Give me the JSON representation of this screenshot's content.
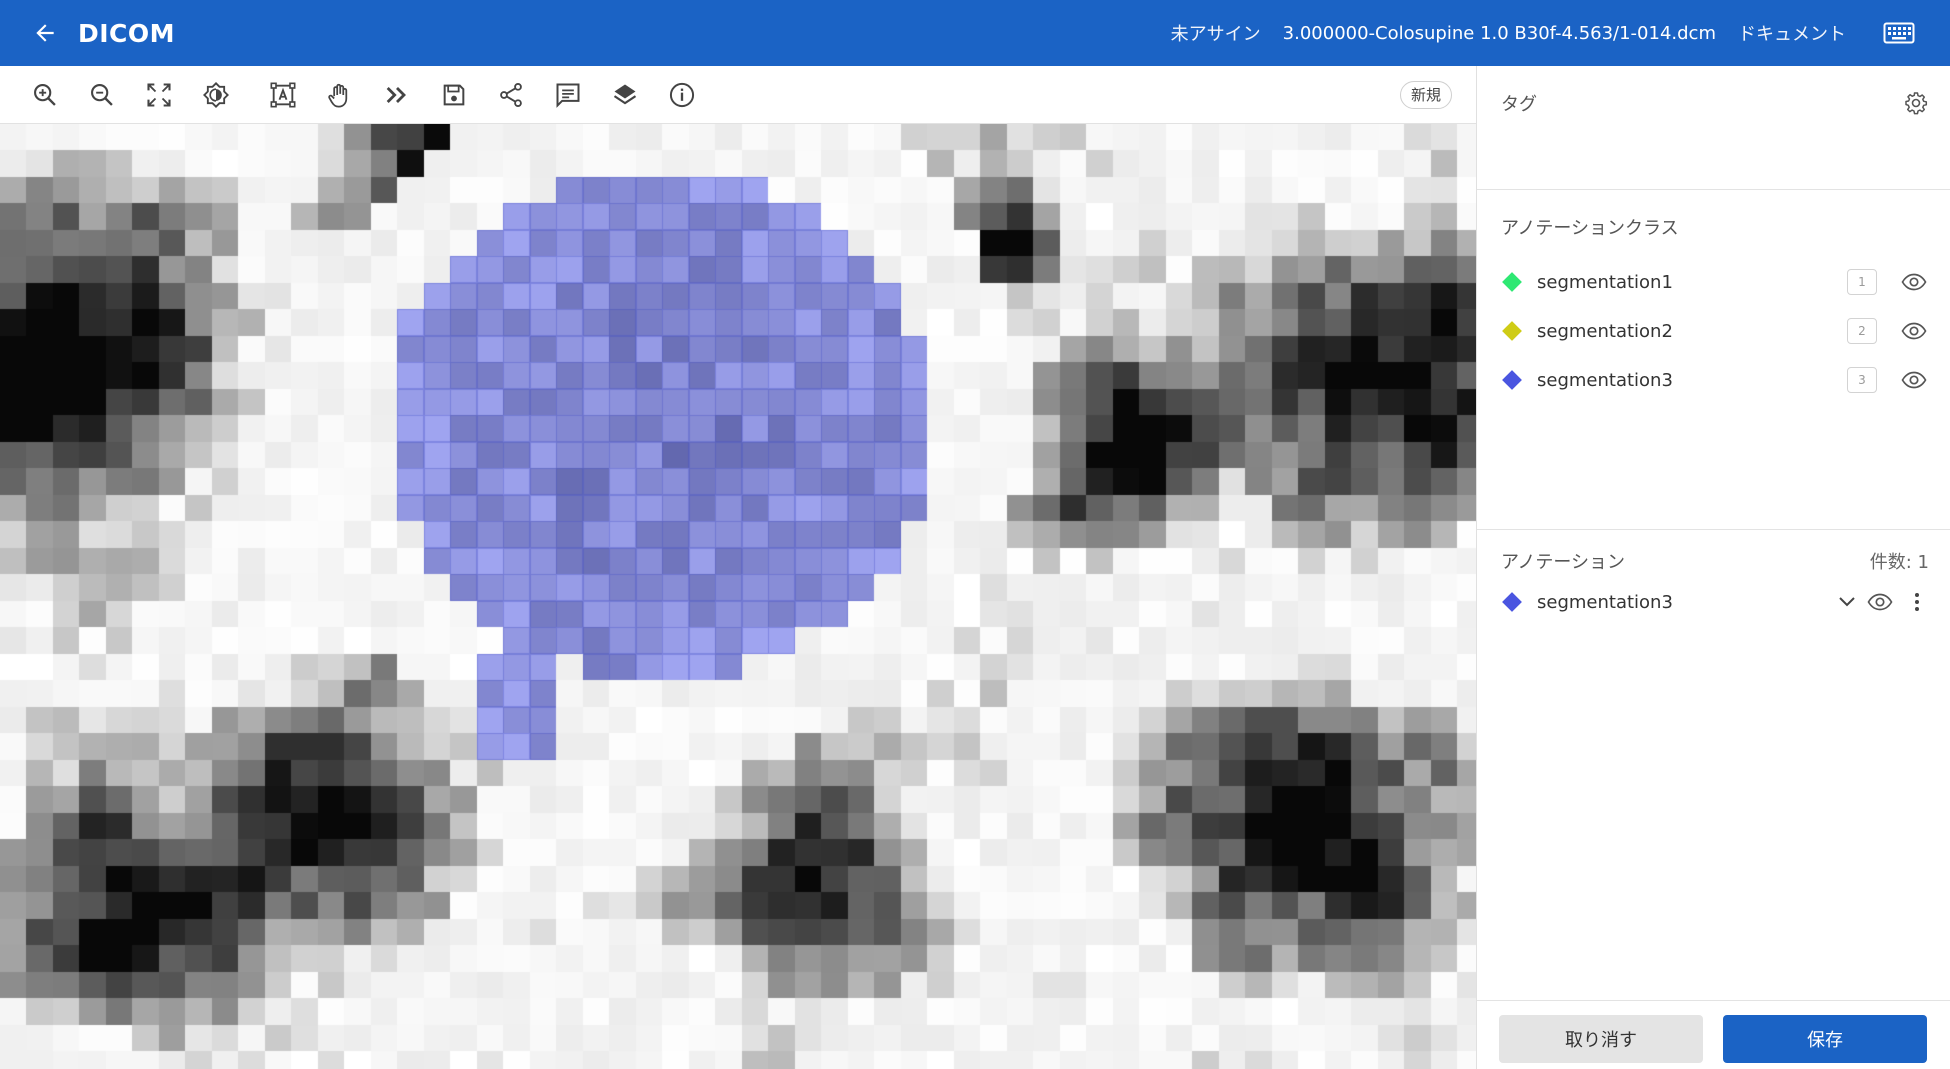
{
  "header": {
    "back_label": "back",
    "title": "DICOM",
    "assignee": "未アサイン",
    "filename": "3.000000-Colosupine 1.0 B30f-4.563/1-014.dcm",
    "document_link": "ドキュメント"
  },
  "toolbar": {
    "tools": [
      {
        "name": "zoom-in-icon"
      },
      {
        "name": "zoom-out-icon"
      },
      {
        "name": "fit-screen-icon"
      },
      {
        "name": "contrast-icon"
      },
      {
        "name": "text-box-icon"
      },
      {
        "name": "pan-hand-icon"
      },
      {
        "name": "fast-forward-icon"
      },
      {
        "name": "save-icon"
      },
      {
        "name": "share-icon"
      },
      {
        "name": "comment-icon"
      },
      {
        "name": "layers-icon"
      },
      {
        "name": "info-icon"
      }
    ],
    "new_badge": "新規"
  },
  "panel": {
    "tags": {
      "title": "タグ"
    },
    "classes": {
      "title": "アノテーションクラス",
      "items": [
        {
          "label": "segmentation1",
          "hotkey": "1",
          "color": "#2ee873"
        },
        {
          "label": "segmentation2",
          "hotkey": "2",
          "color": "#cfcc16"
        },
        {
          "label": "segmentation3",
          "hotkey": "3",
          "color": "#4a55e0"
        }
      ]
    },
    "annotations": {
      "title": "アノテーション",
      "count_label": "件数: 1",
      "items": [
        {
          "label": "segmentation3",
          "color": "#4a55e0"
        }
      ]
    }
  },
  "footer": {
    "cancel_label": "取り消す",
    "save_label": "保存"
  },
  "theme": {
    "primary": "#1b63c5",
    "overlay": "#6f78cc"
  }
}
